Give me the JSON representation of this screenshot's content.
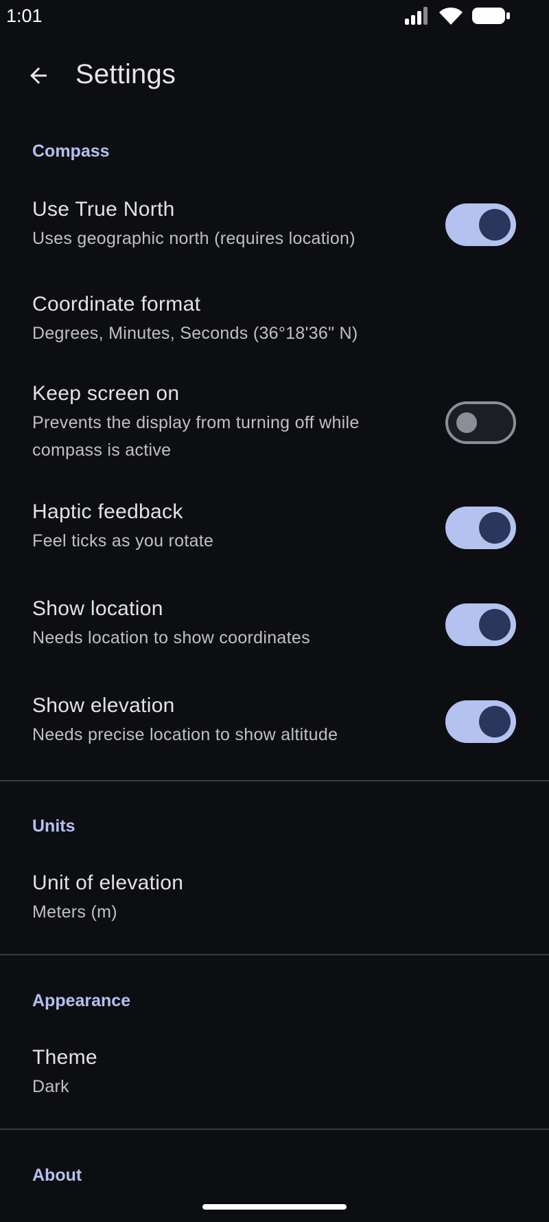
{
  "status_bar": {
    "time": "1:01",
    "icons": [
      "signal-icon",
      "wifi-icon",
      "battery-icon"
    ]
  },
  "app_bar": {
    "back_icon": "arrow-left-icon",
    "title": "Settings"
  },
  "sections": {
    "compass": {
      "header": "Compass",
      "items": [
        {
          "title": "Use True North",
          "subtitle": "Uses geographic north (requires location)",
          "toggle": true,
          "checked": true
        },
        {
          "title": "Coordinate format",
          "subtitle": "Degrees, Minutes, Seconds (36°18'36\" N)",
          "toggle": false
        },
        {
          "title": "Keep screen on",
          "subtitle": "Prevents the display from turning off while compass is active",
          "toggle": true,
          "checked": false
        },
        {
          "title": "Haptic feedback",
          "subtitle": "Feel ticks as you rotate",
          "toggle": true,
          "checked": true
        },
        {
          "title": "Show location",
          "subtitle": "Needs location to show coordinates",
          "toggle": true,
          "checked": true
        },
        {
          "title": "Show elevation",
          "subtitle": "Needs precise location to show altitude",
          "toggle": true,
          "checked": true
        }
      ]
    },
    "units": {
      "header": "Units",
      "items": [
        {
          "title": "Unit of elevation",
          "subtitle": "Meters (m)"
        }
      ]
    },
    "appearance": {
      "header": "Appearance",
      "items": [
        {
          "title": "Theme",
          "subtitle": "Dark"
        }
      ]
    },
    "about": {
      "header": "About"
    }
  },
  "colors": {
    "background": "#0d0e12",
    "accent": "#b5c0f0",
    "switch_on_track": "#b4c2f0",
    "switch_on_thumb": "#2b365c",
    "switch_off_outline": "#8c8d96"
  }
}
